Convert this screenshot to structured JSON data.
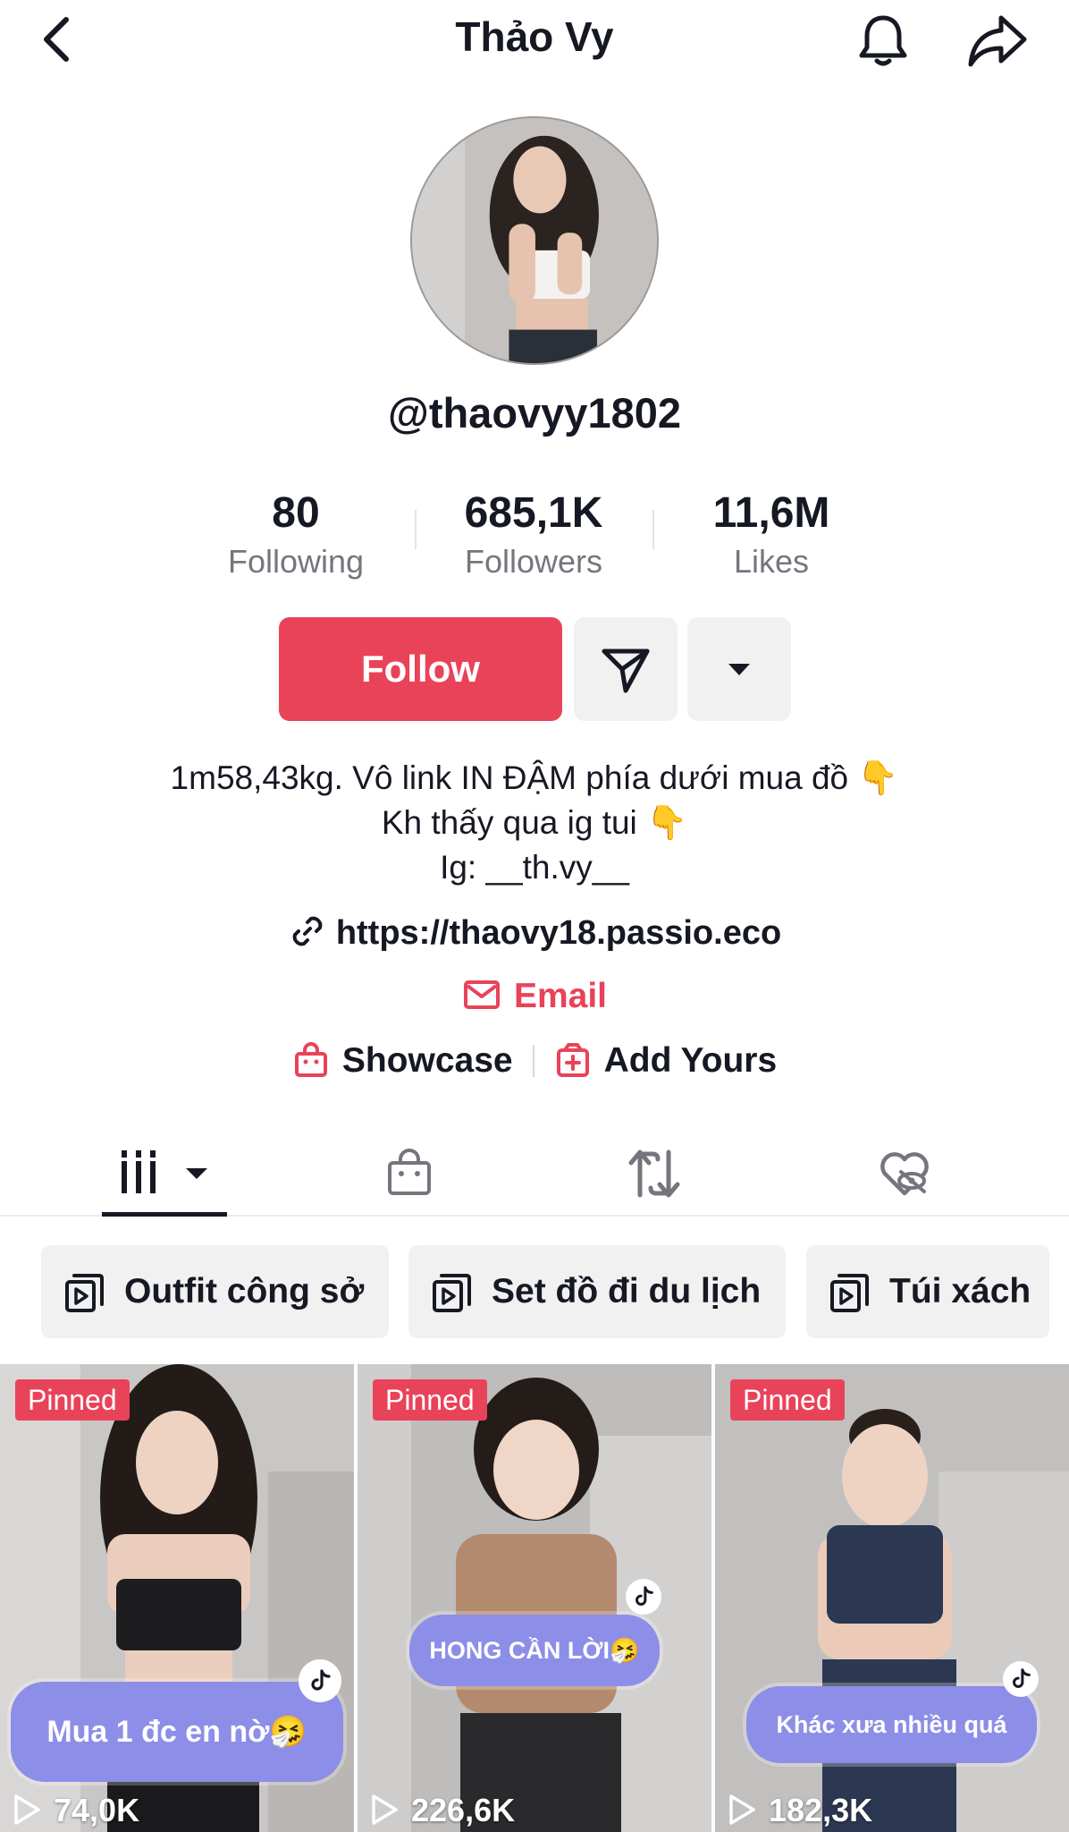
{
  "header": {
    "title": "Thảo Vy",
    "icons": [
      "back-icon",
      "bell-icon",
      "share-icon"
    ]
  },
  "profile": {
    "username": "@thaovyy1802",
    "stats": [
      {
        "value": "80",
        "label": "Following"
      },
      {
        "value": "685,1K",
        "label": "Followers"
      },
      {
        "value": "11,6M",
        "label": "Likes"
      }
    ],
    "follow_label": "Follow",
    "bio_lines": [
      "1m58,43kg. Vô link IN ĐẬM phía dưới mua đồ 👇",
      "Kh thấy qua ig tui 👇",
      "Ig: __th.vy__"
    ],
    "link": "https://thaovy18.passio.eco",
    "email_label": "Email",
    "showcase_label": "Showcase",
    "add_yours_label": "Add Yours"
  },
  "tabs": [
    {
      "name": "videos",
      "icon": "grid-icon",
      "active": true
    },
    {
      "name": "shop",
      "icon": "shopping-bag-icon",
      "active": false
    },
    {
      "name": "reposts",
      "icon": "repost-icon",
      "active": false
    },
    {
      "name": "liked",
      "icon": "hidden-heart-icon",
      "active": false
    }
  ],
  "playlists": [
    {
      "label": "Outfit công sở"
    },
    {
      "label": "Set đồ đi du lịch"
    },
    {
      "label": "Túi xách"
    }
  ],
  "videos": [
    {
      "pinned_label": "Pinned",
      "caption": "Mua 1 đc en nờ🤧",
      "views": "74,0K"
    },
    {
      "pinned_label": "Pinned",
      "caption": "HONG CẦN LỜI🤧",
      "views": "226,6K"
    },
    {
      "pinned_label": "Pinned",
      "caption": "Khác xưa nhiều quá",
      "views": "182,3K"
    }
  ],
  "colors": {
    "accent": "#e9435a",
    "text": "#161823",
    "secondary_text": "#75767d",
    "button_bg": "#f1f1f2",
    "sticker": "#8c8ee8"
  }
}
